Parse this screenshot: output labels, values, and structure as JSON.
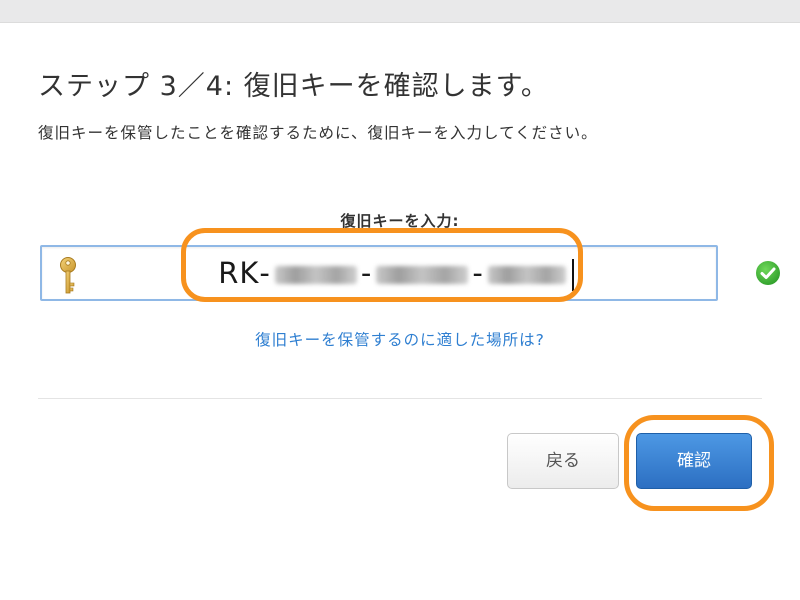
{
  "dialog": {
    "title": "ステップ 3／4: 復旧キーを確認します。",
    "description": "復旧キーを保管したことを確認するために、復旧キーを入力してください。"
  },
  "recovery_key": {
    "label": "復旧キーを入力:",
    "prefix": "RK",
    "separator": "-",
    "masked": true,
    "key_icon": "key-icon",
    "status_icon": "check-circle-icon",
    "status_color": "#34b233"
  },
  "help": {
    "link_text": "復旧キーを保管するのに適した場所は?"
  },
  "buttons": {
    "back_label": "戻る",
    "confirm_label": "確認"
  },
  "colors": {
    "accent": "#2f7fd1",
    "highlight": "#f7921e",
    "field_border": "#8fb8e6",
    "confirm_button": "#3a82d6"
  }
}
